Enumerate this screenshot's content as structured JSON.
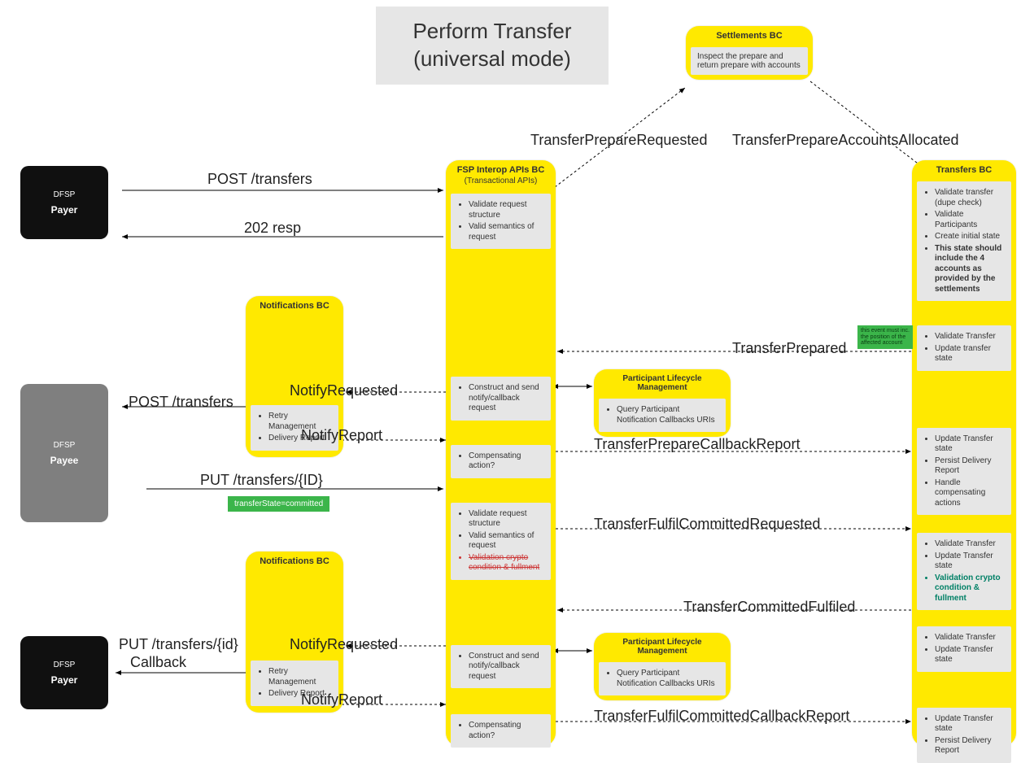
{
  "title": "Perform Transfer\n(universal mode)",
  "actors": {
    "payer1_l1": "DFSP",
    "payer1_l2": "Payer",
    "payee_l1": "DFSP",
    "payee_l2": "Payee",
    "payer2_l1": "DFSP",
    "payer2_l2": "Payer"
  },
  "settlements": {
    "title": "Settlements BC",
    "body": "Inspect the prepare and return prepare with accounts"
  },
  "fsp": {
    "title": "FSP Interop APIs BC",
    "subtitle": "(Transactional APIs)",
    "p1_a": "Validate request structure",
    "p1_b": "Valid semantics of request",
    "p2": "Construct and send notify/callback request",
    "p3": "Compensating action?",
    "p4_a": "Validate request structure",
    "p4_b": "Valid semantics of request",
    "p4_c": "Validation crypto condition & fullment",
    "p5": "Construct and send notify/callback request",
    "p6": "Compensating action?"
  },
  "plm": {
    "title": "Participant Lifecycle Management",
    "body": "Query Participant Notification Callbacks URIs"
  },
  "notifications": {
    "title": "Notifications BC",
    "a": "Retry Management",
    "b": "Delivery Report"
  },
  "transfers": {
    "title": "Transfers BC",
    "p1_a": "Validate transfer (dupe check)",
    "p1_b": "Validate Participants",
    "p1_c": "Create initial state",
    "p1_d": "This state should include the 4 accounts as provided by the settlements",
    "p2_a": "Validate Transfer",
    "p2_b": "Update transfer state",
    "p3_a": "Update Transfer state",
    "p3_b": "Persist Delivery Report",
    "p3_c": "Handle compensating actions",
    "p4_a": "Validate Transfer",
    "p4_b": "Update Transfer state",
    "p4_c": "Validation crypto condition & fullment",
    "p5_a": "Validate Transfer",
    "p5_b": "Update Transfer state",
    "p6_a": "Update Transfer state",
    "p6_b": "Persist Delivery Report"
  },
  "labels": {
    "post_transfers": "POST /transfers",
    "resp_202": "202 resp",
    "transfer_prepare_requested": "TransferPrepareRequested",
    "transfer_prepare_accounts_allocated": "TransferPrepareAccountsAllocated",
    "notify_requested": "NotifyRequested",
    "notify_report": "NotifyReport",
    "post_transfers2": "POST /transfers",
    "put_transfers_id": "PUT /transfers/{ID}",
    "transfer_state_committed": "transferState=committed",
    "transfer_prepared": "TransferPrepared",
    "transfer_prepare_callback_report": "TransferPrepareCallbackReport",
    "transfer_fulfil_committed_requested": "TransferFulfilCommittedRequested",
    "transfer_committed_fulfilled": "TransferCommittedFulfiled",
    "transfer_fulfil_committed_callback_report": "TransferFulfilCommittedCallbackReport",
    "put_transfers_id_lc": "PUT /transfers/{id}",
    "callback": "Callback",
    "green_note": "this event must inc. the position of the affected account"
  }
}
